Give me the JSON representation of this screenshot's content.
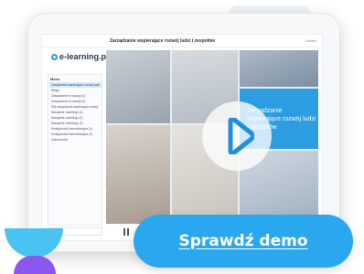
{
  "course": {
    "title": "Zarządzanie wspierające rozwój ludzi i zespołów",
    "top_right": "Zamknij"
  },
  "logo": {
    "text": "e-learning.pl"
  },
  "sidebar": {
    "menu_label": "Menu",
    "items": [
      {
        "label": "Zarządzanie wspierające rozwój ludzi",
        "active": true
      },
      {
        "label": "Wstęp",
        "active": false
      },
      {
        "label": "Zarządzanie w rozwoju (1)",
        "active": false
      },
      {
        "label": "Zarządzanie w rozwoju (2)",
        "active": false
      },
      {
        "label": "Styl zarządzania wspierający rozwój",
        "active": false
      },
      {
        "label": "Narzędzie coachingu (1)",
        "active": false
      },
      {
        "label": "Narzędzie coachingu (2)",
        "active": false
      },
      {
        "label": "Narzędzie coachingu (3)",
        "active": false
      },
      {
        "label": "Umiejętności komunikacyjne (1)",
        "active": false
      },
      {
        "label": "Umiejętności komunikacyjne (2)",
        "active": false
      },
      {
        "label": "Zakończenie",
        "active": false
      }
    ]
  },
  "slide": {
    "title": "Zarządzanie wspierające rozwój ludzi i zespołów"
  },
  "cta": {
    "label": "Sprawdź demo"
  },
  "colors": {
    "accent_blue": "#2aa7ef",
    "panel_blue": "#2b9de0",
    "deco_cyan": "#4ac3f2",
    "deco_purple": "#8b57f0"
  }
}
